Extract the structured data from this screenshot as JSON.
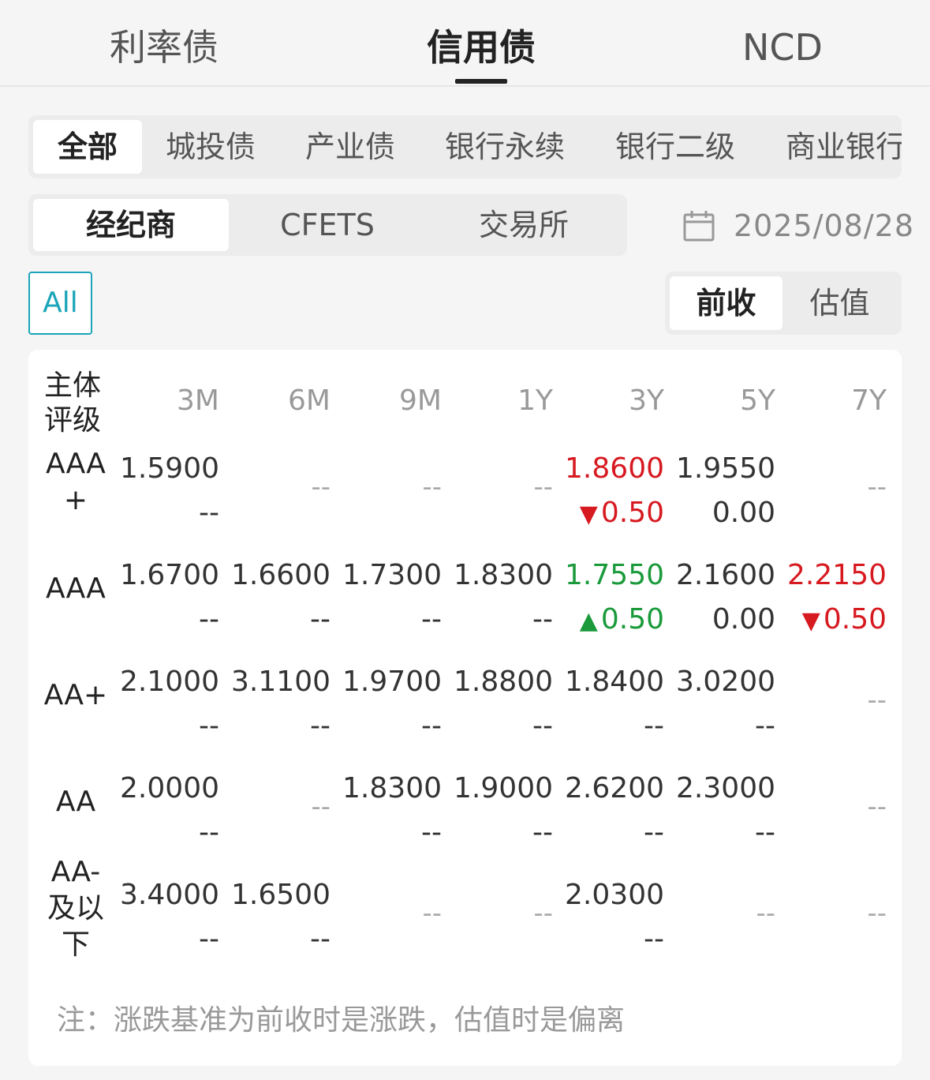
{
  "top_tabs": [
    {
      "label": "利率债",
      "active": false
    },
    {
      "label": "信用债",
      "active": true
    },
    {
      "label": "NCD",
      "active": false
    }
  ],
  "categories": [
    "全部",
    "城投债",
    "产业债",
    "银行永续",
    "银行二级",
    "商业银行"
  ],
  "sources": [
    "经纪商",
    "CFETS",
    "交易所"
  ],
  "date": "2025/08/28",
  "all_label": "All",
  "modes": [
    "前收",
    "估值"
  ],
  "table": {
    "rating_header": [
      "主体",
      "评级"
    ],
    "tenors": [
      "3M",
      "6M",
      "9M",
      "1Y",
      "3Y",
      "5Y",
      "7Y"
    ],
    "rows": [
      {
        "label": [
          "AAA",
          "+"
        ],
        "cells": [
          {
            "value": "1.5900",
            "change": "--"
          },
          {
            "empty": "--"
          },
          {
            "empty": "--"
          },
          {
            "empty": "--"
          },
          {
            "value": "1.8600",
            "change": "0.50",
            "dir": "down"
          },
          {
            "value": "1.9550",
            "change": "0.00"
          },
          {
            "empty": "--"
          }
        ]
      },
      {
        "label": [
          "AAA"
        ],
        "cells": [
          {
            "value": "1.6700",
            "change": "--"
          },
          {
            "value": "1.6600",
            "change": "--"
          },
          {
            "value": "1.7300",
            "change": "--"
          },
          {
            "value": "1.8300",
            "change": "--"
          },
          {
            "value": "1.7550",
            "change": "0.50",
            "dir": "up"
          },
          {
            "value": "2.1600",
            "change": "0.00"
          },
          {
            "value": "2.2150",
            "change": "0.50",
            "dir": "down"
          }
        ]
      },
      {
        "label": [
          "AA+"
        ],
        "cells": [
          {
            "value": "2.1000",
            "change": "--"
          },
          {
            "value": "3.1100",
            "change": "--"
          },
          {
            "value": "1.9700",
            "change": "--"
          },
          {
            "value": "1.8800",
            "change": "--"
          },
          {
            "value": "1.8400",
            "change": "--"
          },
          {
            "value": "3.0200",
            "change": "--"
          },
          {
            "empty": "--"
          }
        ]
      },
      {
        "label": [
          "AA"
        ],
        "cells": [
          {
            "value": "2.0000",
            "change": "--"
          },
          {
            "empty": "--"
          },
          {
            "value": "1.8300",
            "change": "--"
          },
          {
            "value": "1.9000",
            "change": "--"
          },
          {
            "value": "2.6200",
            "change": "--"
          },
          {
            "value": "2.3000",
            "change": "--"
          },
          {
            "empty": "--"
          }
        ]
      },
      {
        "label": [
          "AA-",
          "及以",
          "下"
        ],
        "cells": [
          {
            "value": "3.4000",
            "change": "--"
          },
          {
            "value": "1.6500",
            "change": "--"
          },
          {
            "empty": "--"
          },
          {
            "empty": "--"
          },
          {
            "value": "2.0300",
            "change": "--"
          },
          {
            "empty": "--"
          },
          {
            "empty": "--"
          }
        ]
      }
    ]
  },
  "note": "注：涨跌基准为前收时是涨跌，估值时是偏离",
  "colors": {
    "accent": "#1aa5b8",
    "up": "#1a9a3a",
    "down": "#d71920"
  }
}
